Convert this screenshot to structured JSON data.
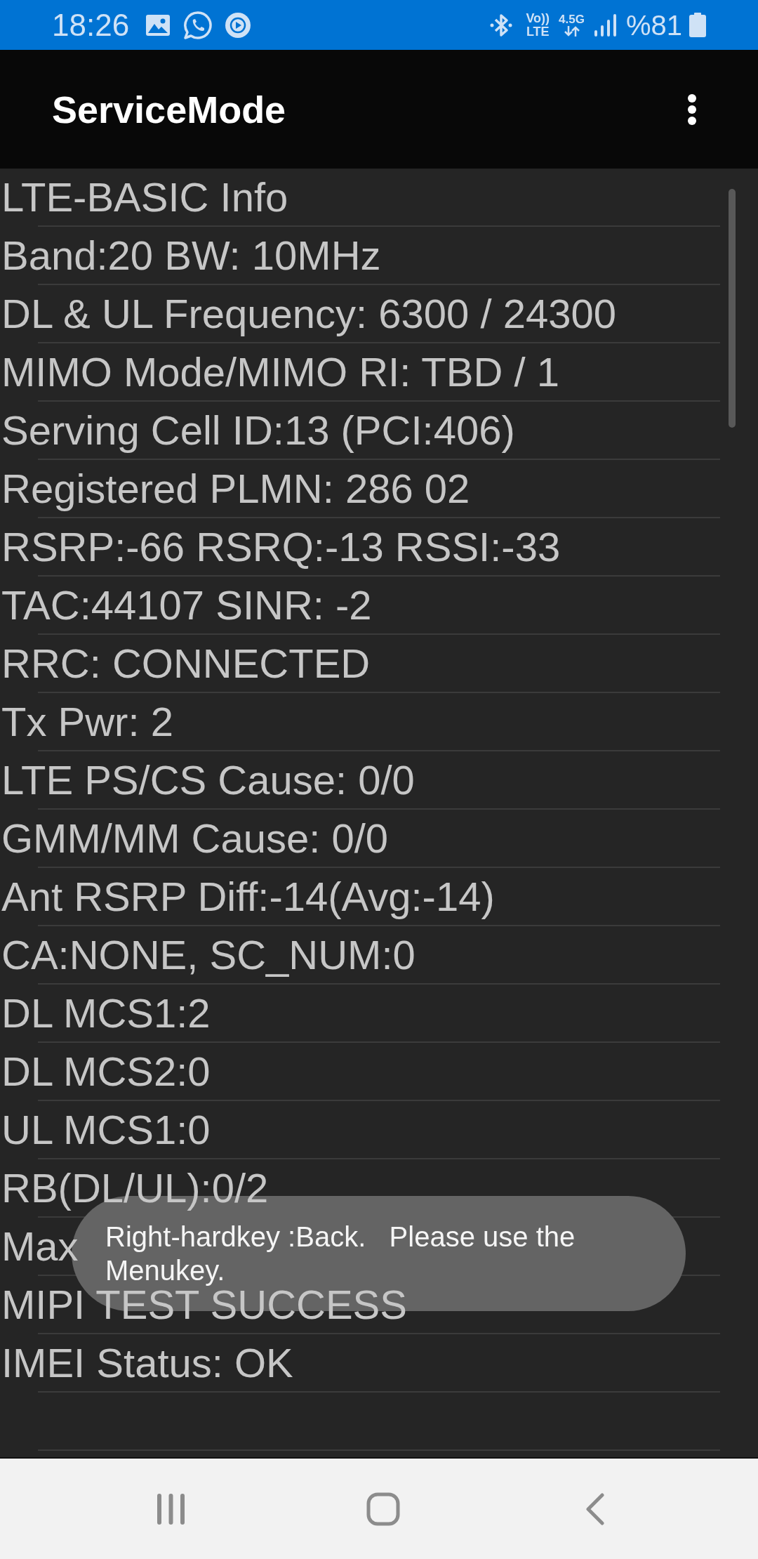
{
  "status_bar": {
    "time": "18:26",
    "volte": [
      "Vo))",
      "LTE"
    ],
    "network_type": "4.5G",
    "battery_percent": "%81"
  },
  "toolbar": {
    "title": "ServiceMode"
  },
  "rows": [
    "LTE-BASIC Info",
    "Band:20 BW: 10MHz",
    "DL & UL Frequency: 6300 / 24300",
    "MIMO Mode/MIMO RI: TBD / 1",
    "Serving Cell ID:13 (PCI:406)",
    "Registered PLMN: 286 02",
    "RSRP:-66 RSRQ:-13 RSSI:-33",
    "TAC:44107 SINR: -2",
    "RRC: CONNECTED",
    "Tx Pwr: 2",
    "LTE PS/CS Cause: 0/0",
    "GMM/MM Cause: 0/0",
    "Ant RSRP Diff:-14(Avg:-14)",
    "CA:NONE, SC_NUM:0",
    "DL MCS1:2",
    "DL MCS2:0",
    "UL MCS1:0",
    "RB(DL/UL):0/2",
    "Max",
    "MIPI TEST SUCCESS",
    "IMEI Status: OK"
  ],
  "toast": {
    "message": "Right-hardkey :Back.   Please use the Menukey."
  }
}
